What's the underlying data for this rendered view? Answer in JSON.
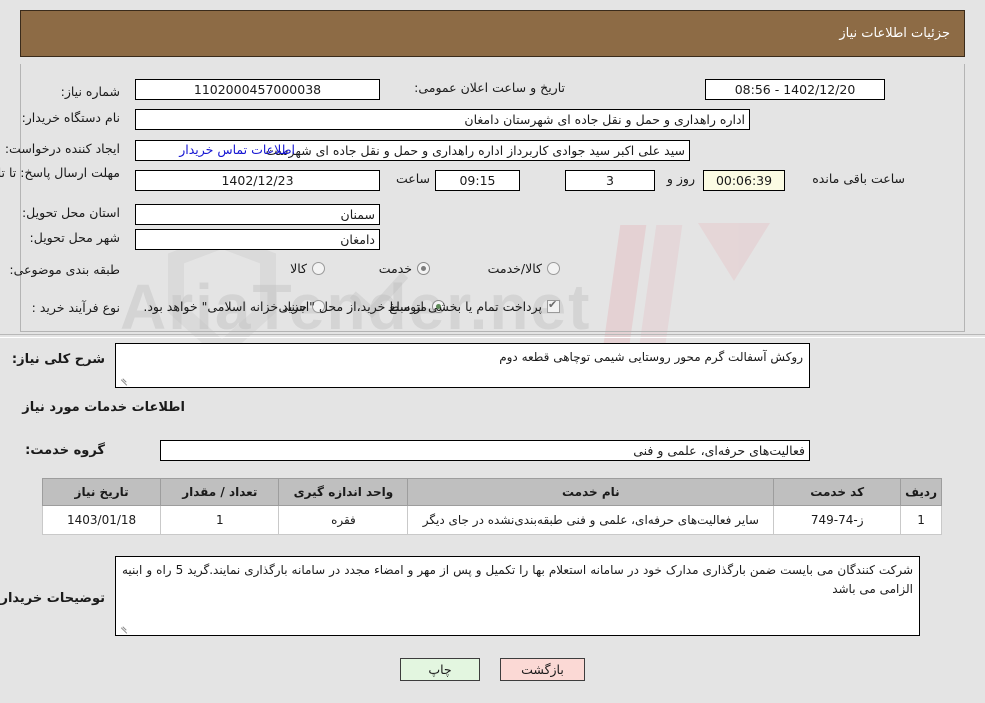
{
  "header": {
    "title": "جزئیات اطلاعات نیاز"
  },
  "form": {
    "need_number_label": "شماره نیاز:",
    "need_number_value": "1102000457000038",
    "public_announce_label": "تاریخ و ساعت اعلان عمومی:",
    "public_announce_value": "1402/12/20 - 08:56",
    "buyer_org_label": "نام دستگاه خریدار:",
    "buyer_org_value": "اداره راهداری و حمل و نقل جاده ای شهرستان دامغان",
    "creator_label": "ایجاد کننده درخواست:",
    "creator_value": "سید علی اکبر سید جوادی کاربرداز اداره راهداری و حمل و نقل جاده ای شهرست",
    "buyer_contact_link": "اطلاعات تماس خریدار",
    "deadline_label": "مهلت ارسال پاسخ: تا تاریخ:",
    "deadline_date": "1402/12/23",
    "deadline_time_label": "ساعت",
    "deadline_time": "09:15",
    "remaining_days": "3",
    "days_and_label": "روز و",
    "remaining_clock": "00:06:39",
    "remaining_suffix": "ساعت باقی مانده",
    "province_label": "استان محل تحویل:",
    "province_value": "سمنان",
    "city_label": "شهر محل تحویل:",
    "city_value": "دامغان",
    "category_label": "طبقه بندی موضوعی:",
    "category_options": [
      {
        "label": "کالا",
        "selected": false
      },
      {
        "label": "خدمت",
        "selected": true
      },
      {
        "label": "کالا/خدمت",
        "selected": false
      }
    ],
    "purchase_type_label": "نوع فرآیند خرید :",
    "purchase_type_options": [
      {
        "label": "جزیی",
        "selected": false
      },
      {
        "label": "متوسط",
        "selected": true
      }
    ],
    "treasury_checkbox_label": "پرداخت تمام یا بخشی از مبلغ خرید،از محل \"اسناد خزانه اسلامی\" خواهد بود.",
    "treasury_checked": true
  },
  "lower": {
    "general_desc_label": "شرح کلی نیاز:",
    "general_desc_value": "روکش آسفالت گرم محور روستایی شیمی توچاهی قطعه دوم",
    "services_section_title": "اطلاعات خدمات مورد نیاز",
    "service_group_label": "گروه خدمت:",
    "service_group_value": "فعالیت‌های حرفه‌ای، علمی و فنی",
    "buyer_notes_label": "توضیحات خریدار:",
    "buyer_notes_value": "شرکت کنندگان می بایست ضمن بارگذاری مدارک خود در سامانه استعلام بها را تکمیل و پس از مهر و امضاء مجدد در سامانه بارگذاری نمایند.گرید 5 راه و ابنیه الزامی می باشد"
  },
  "table": {
    "headers": [
      "ردیف",
      "کد خدمت",
      "نام خدمت",
      "واحد اندازه گیری",
      "تعداد / مقدار",
      "تاریخ نیاز"
    ],
    "rows": [
      {
        "row": "1",
        "code": "ز-74-749",
        "name": "سایر فعالیت‌های حرفه‌ای، علمی و فنی طبقه‌بندی‌نشده در جای دیگر",
        "unit": "فقره",
        "qty": "1",
        "date": "1403/01/18"
      }
    ]
  },
  "buttons": {
    "print": "چاپ",
    "back": "بازگشت"
  },
  "watermark": {
    "text": "AriaTender.net"
  },
  "colors": {
    "header_bg": "#8d6b45",
    "link": "#1414d2",
    "print_btn": "#e3f6e0",
    "back_btn": "#fbd9d5",
    "highlight_field": "#fbfbe3"
  }
}
